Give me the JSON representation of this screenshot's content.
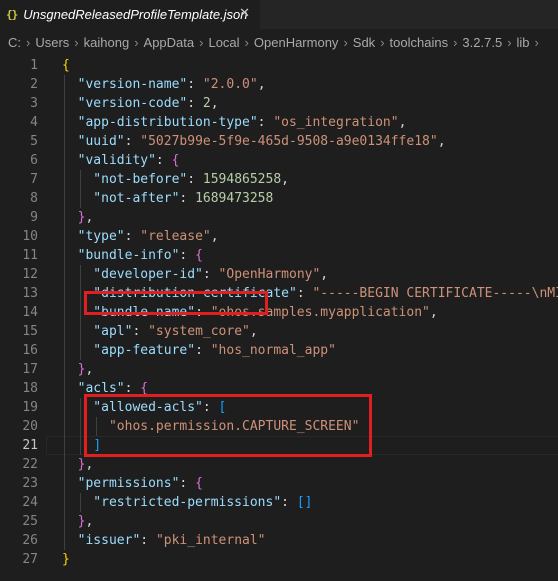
{
  "tab": {
    "icon": "{}",
    "title": "UnsgnedReleasedProfileTemplate.json",
    "close": "✕"
  },
  "breadcrumb": [
    "C:",
    "Users",
    "kaihong",
    "AppData",
    "Local",
    "OpenHarmony",
    "Sdk",
    "toolchains",
    "3.2.7.5",
    "lib"
  ],
  "breadcrumb_more": "›",
  "lines": [
    {
      "n": "1",
      "t": [
        [
          "{",
          "b1"
        ]
      ]
    },
    {
      "n": "2",
      "t": [
        [
          "  \"version-name\"",
          "k"
        ],
        [
          ": ",
          "p"
        ],
        [
          "\"2.0.0\"",
          "s"
        ],
        [
          ",",
          "p"
        ]
      ]
    },
    {
      "n": "3",
      "t": [
        [
          "  \"version-code\"",
          "k"
        ],
        [
          ": ",
          "p"
        ],
        [
          "2",
          "n"
        ],
        [
          ",",
          "p"
        ]
      ]
    },
    {
      "n": "4",
      "t": [
        [
          "  \"app-distribution-type\"",
          "k"
        ],
        [
          ": ",
          "p"
        ],
        [
          "\"os_integration\"",
          "s"
        ],
        [
          ",",
          "p"
        ]
      ]
    },
    {
      "n": "5",
      "t": [
        [
          "  \"uuid\"",
          "k"
        ],
        [
          ": ",
          "p"
        ],
        [
          "\"5027b99e-5f9e-465d-9508-a9e0134ffe18\"",
          "s"
        ],
        [
          ",",
          "p"
        ]
      ]
    },
    {
      "n": "6",
      "t": [
        [
          "  \"validity\"",
          "k"
        ],
        [
          ": ",
          "p"
        ],
        [
          "{",
          "b2"
        ]
      ]
    },
    {
      "n": "7",
      "t": [
        [
          "    \"not-before\"",
          "k"
        ],
        [
          ": ",
          "p"
        ],
        [
          "1594865258",
          "n"
        ],
        [
          ",",
          "p"
        ]
      ]
    },
    {
      "n": "8",
      "t": [
        [
          "    \"not-after\"",
          "k"
        ],
        [
          ": ",
          "p"
        ],
        [
          "1689473258",
          "n"
        ]
      ]
    },
    {
      "n": "9",
      "t": [
        [
          "  ",
          "p"
        ],
        [
          "}",
          "b2"
        ],
        [
          ",",
          "p"
        ]
      ]
    },
    {
      "n": "10",
      "t": [
        [
          "  \"type\"",
          "k"
        ],
        [
          ": ",
          "p"
        ],
        [
          "\"release\"",
          "s"
        ],
        [
          ",",
          "p"
        ]
      ]
    },
    {
      "n": "11",
      "t": [
        [
          "  \"bundle-info\"",
          "k"
        ],
        [
          ": ",
          "p"
        ],
        [
          "{",
          "b2"
        ]
      ]
    },
    {
      "n": "12",
      "t": [
        [
          "    \"developer-id\"",
          "k"
        ],
        [
          ": ",
          "p"
        ],
        [
          "\"OpenHarmony\"",
          "s"
        ],
        [
          ",",
          "p"
        ]
      ]
    },
    {
      "n": "13",
      "t": [
        [
          "    \"distribution-certificate\"",
          "k"
        ],
        [
          ": ",
          "p"
        ],
        [
          "\"-----BEGIN CERTIFICATE-----\\nMI",
          "s"
        ]
      ]
    },
    {
      "n": "14",
      "t": [
        [
          "    \"bundle-name\"",
          "k"
        ],
        [
          ": ",
          "p"
        ],
        [
          "\"ohos.samples.myapplication\"",
          "s"
        ],
        [
          ",",
          "p"
        ]
      ]
    },
    {
      "n": "15",
      "t": [
        [
          "    \"apl\"",
          "k"
        ],
        [
          ": ",
          "p"
        ],
        [
          "\"system_core\"",
          "s"
        ],
        [
          ",",
          "p"
        ]
      ]
    },
    {
      "n": "16",
      "t": [
        [
          "    \"app-feature\"",
          "k"
        ],
        [
          ": ",
          "p"
        ],
        [
          "\"hos_normal_app\"",
          "s"
        ]
      ]
    },
    {
      "n": "17",
      "t": [
        [
          "  ",
          "p"
        ],
        [
          "}",
          "b2"
        ],
        [
          ",",
          "p"
        ]
      ]
    },
    {
      "n": "18",
      "t": [
        [
          "  \"acls\"",
          "k"
        ],
        [
          ": ",
          "p"
        ],
        [
          "{",
          "b2"
        ]
      ]
    },
    {
      "n": "19",
      "t": [
        [
          "    \"allowed-acls\"",
          "k"
        ],
        [
          ": ",
          "p"
        ],
        [
          "[",
          "b3"
        ]
      ]
    },
    {
      "n": "20",
      "t": [
        [
          "      \"ohos.permission.CAPTURE_SCREEN\"",
          "s"
        ]
      ]
    },
    {
      "n": "21",
      "t": [
        [
          "    ",
          "p"
        ],
        [
          "]",
          "b3"
        ]
      ]
    },
    {
      "n": "22",
      "t": [
        [
          "  ",
          "p"
        ],
        [
          "}",
          "b2"
        ],
        [
          ",",
          "p"
        ]
      ]
    },
    {
      "n": "23",
      "t": [
        [
          "  \"permissions\"",
          "k"
        ],
        [
          ": ",
          "p"
        ],
        [
          "{",
          "b2"
        ]
      ]
    },
    {
      "n": "24",
      "t": [
        [
          "    \"restricted-permissions\"",
          "k"
        ],
        [
          ": ",
          "p"
        ],
        [
          "[]",
          "b3"
        ]
      ]
    },
    {
      "n": "25",
      "t": [
        [
          "  ",
          "p"
        ],
        [
          "}",
          "b2"
        ],
        [
          ",",
          "p"
        ]
      ]
    },
    {
      "n": "26",
      "t": [
        [
          "  \"issuer\"",
          "k"
        ],
        [
          ": ",
          "p"
        ],
        [
          "\"pki_internal\"",
          "s"
        ]
      ]
    },
    {
      "n": "27",
      "t": [
        [
          "}",
          "b1"
        ]
      ]
    }
  ],
  "active_line": "21",
  "highlight_color": "#e02020"
}
